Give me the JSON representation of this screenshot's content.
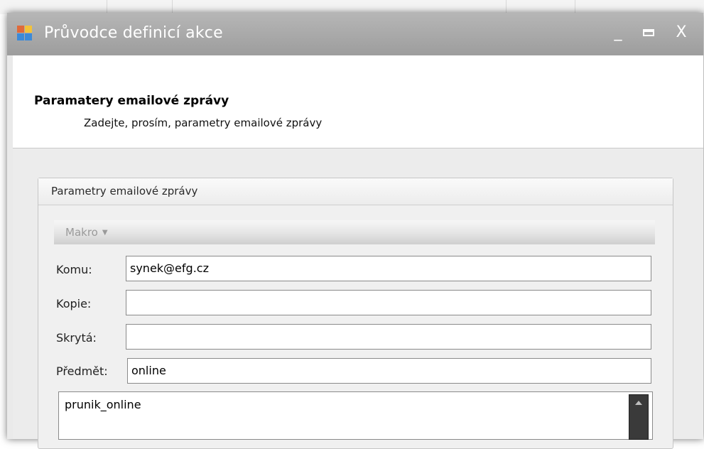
{
  "window": {
    "title": "Průvodce definicí akce",
    "controls": {
      "minimize": "_",
      "close": "X"
    }
  },
  "header": {
    "title": "Paramatery emailové zprávy",
    "subtitle": "Zadejte, prosím, parametry emailové zprávy"
  },
  "group": {
    "title": "Parametry emailové zprávy"
  },
  "macro": {
    "label": "Makro",
    "caret": "▼"
  },
  "fields": {
    "to": {
      "label": "Komu:",
      "value": "synek@efg.cz"
    },
    "cc": {
      "label": "Kopie:",
      "value": ""
    },
    "bcc": {
      "label": "Skrytá:",
      "value": ""
    },
    "subject": {
      "label": "Předmět:",
      "value": "online"
    }
  },
  "body": {
    "value": "prunik_online"
  },
  "colors": {
    "titlebar": "#a8a8a8",
    "window_bg": "#eaeaea",
    "field_border": "#8a8a8a"
  },
  "icons": [
    "app-icon",
    "minimize-icon",
    "maximize-icon",
    "close-icon",
    "chevron-down-icon",
    "scroll-up-icon"
  ]
}
